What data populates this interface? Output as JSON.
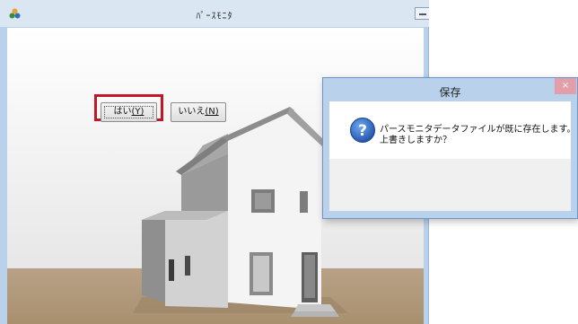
{
  "parse_window": {
    "title": "ﾊﾟｰｽﾓﾆﾀ"
  },
  "dialog": {
    "title": "保存",
    "close_glyph": "×",
    "message_line1": "パースモニタデータファイルが既に存在します。",
    "message_line2": "上書きしますか？",
    "yes": {
      "label": "はい",
      "mnemonic": "(Y)"
    },
    "no": {
      "label": "いいえ",
      "mnemonic": "(N)"
    }
  },
  "colors": {
    "title_bar": "#dbe6f3",
    "dialog_frame": "#b9d1ea",
    "highlight": "#c21826",
    "close_button": "#e39fa9"
  },
  "icons": {
    "app": "app-logo-icon",
    "dialog": "question-icon"
  }
}
